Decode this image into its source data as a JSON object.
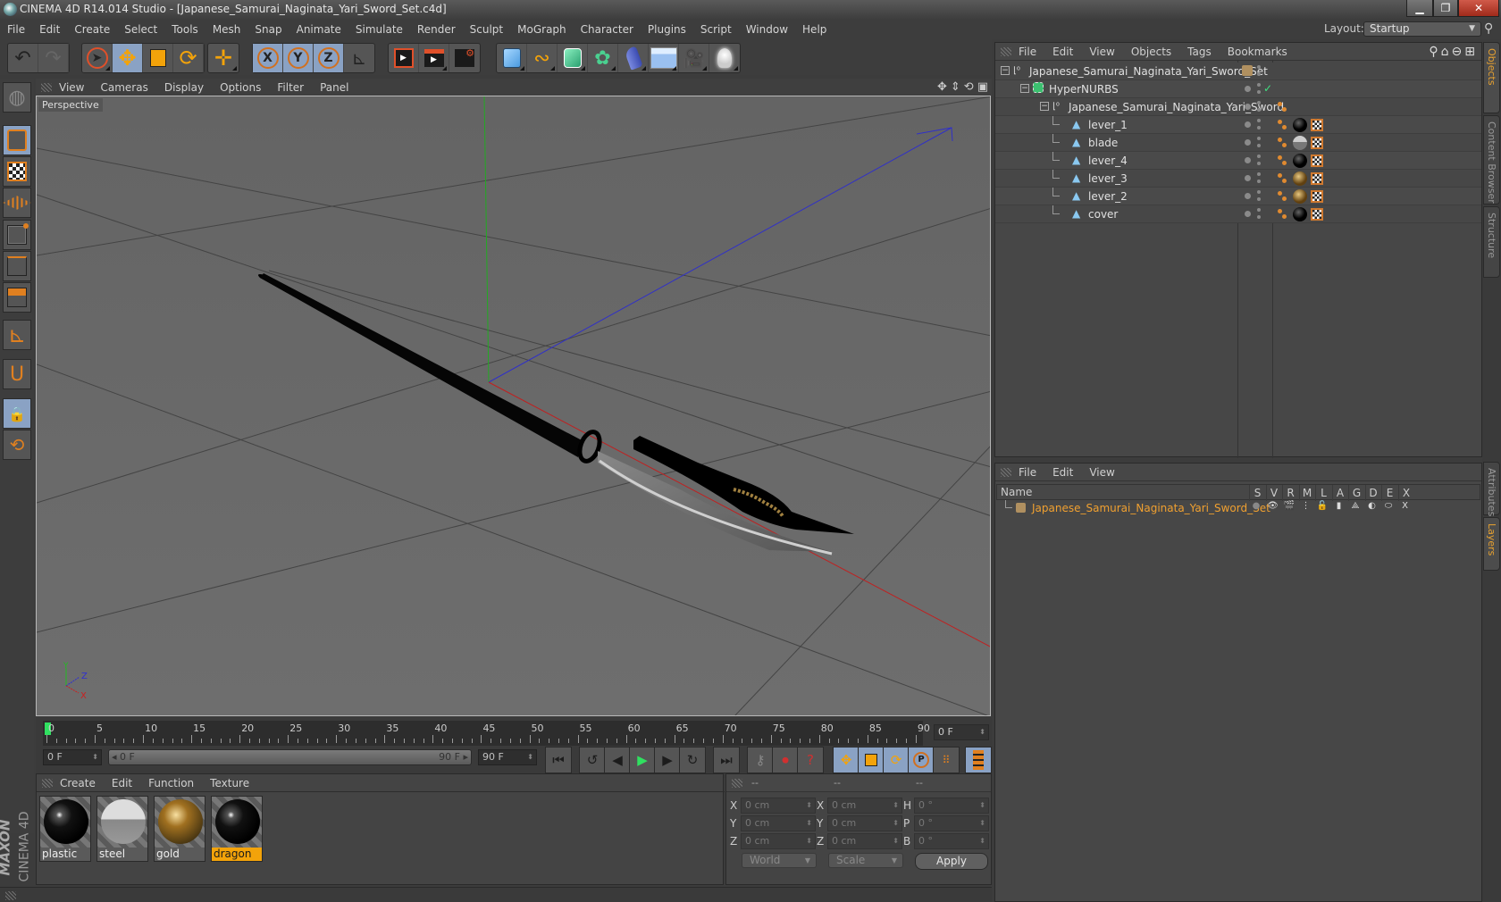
{
  "window": {
    "title": "CINEMA 4D R14.014 Studio - [Japanese_Samurai_Naginata_Yari_Sword_Set.c4d]",
    "minimize": "▁",
    "restore": "❐",
    "close": "✕"
  },
  "menubar": [
    "File",
    "Edit",
    "Create",
    "Select",
    "Tools",
    "Mesh",
    "Snap",
    "Animate",
    "Simulate",
    "Render",
    "Sculpt",
    "MoGraph",
    "Character",
    "Plugins",
    "Script",
    "Window",
    "Help"
  ],
  "layout": {
    "label": "Layout:",
    "value": "Startup"
  },
  "toolbar": {
    "groups": [
      [
        "undo-icon",
        "redo-icon"
      ],
      [
        "live-selection-icon",
        "move-icon",
        "scale-icon",
        "rotate-icon"
      ],
      [
        "add-object-icon"
      ],
      [
        "x-axis-icon",
        "y-axis-icon",
        "z-axis-icon",
        "coordinate-system-icon"
      ],
      [
        "render-view-icon",
        "render-picture-viewer-icon",
        "render-settings-icon"
      ],
      [
        "cube-icon",
        "spline-icon",
        "nurbs-icon",
        "mograph-cloner-icon",
        "deformer-icon",
        "floor-icon",
        "camera-icon",
        "light-icon"
      ]
    ]
  },
  "viewport": {
    "menu": [
      "View",
      "Cameras",
      "Display",
      "Options",
      "Filter",
      "Panel"
    ],
    "label": "Perspective",
    "axis": {
      "y": "Y",
      "z": "Z",
      "x": "X"
    }
  },
  "timeline": {
    "ticks": [
      "0",
      "5",
      "10",
      "15",
      "20",
      "25",
      "30",
      "35",
      "40",
      "45",
      "50",
      "55",
      "60",
      "65",
      "70",
      "75",
      "80",
      "85",
      "90"
    ],
    "current_frame": "0 F",
    "start_field": "0 F",
    "range_start": "0 F",
    "range_end": "90 F",
    "end_field": "90 F"
  },
  "materials": {
    "menu": [
      "Create",
      "Edit",
      "Function",
      "Texture"
    ],
    "items": [
      {
        "name": "plastic",
        "selected": false
      },
      {
        "name": "steel",
        "selected": false
      },
      {
        "name": "gold",
        "selected": false
      },
      {
        "name": "dragon",
        "selected": true
      }
    ]
  },
  "coords": {
    "headers": [
      "--",
      "--",
      "--"
    ],
    "pos": [
      {
        "axis": "X",
        "value": "0 cm"
      },
      {
        "axis": "Y",
        "value": "0 cm"
      },
      {
        "axis": "Z",
        "value": "0 cm"
      }
    ],
    "size": [
      {
        "axis": "X",
        "value": "0 cm"
      },
      {
        "axis": "Y",
        "value": "0 cm"
      },
      {
        "axis": "Z",
        "value": "0 cm"
      }
    ],
    "rot": [
      {
        "axis": "H",
        "value": "0 °"
      },
      {
        "axis": "P",
        "value": "0 °"
      },
      {
        "axis": "B",
        "value": "0 °"
      }
    ],
    "mode": "World",
    "transform": "Scale",
    "apply": "Apply"
  },
  "objects": {
    "menu": [
      "File",
      "Edit",
      "View",
      "Objects",
      "Tags",
      "Bookmarks"
    ],
    "rows": [
      {
        "name": "Japanese_Samurai_Naginata_Yari_Sword_Set",
        "type": "null",
        "depth": 0
      },
      {
        "name": "HyperNURBS",
        "type": "hypernurbs",
        "depth": 1
      },
      {
        "name": "Japanese_Samurai_Naginata_Yari_Sword",
        "type": "null",
        "depth": 2
      },
      {
        "name": "lever_1",
        "type": "polygon",
        "depth": 3,
        "material": "plastic"
      },
      {
        "name": "blade",
        "type": "polygon",
        "depth": 3,
        "material": "steel"
      },
      {
        "name": "lever_4",
        "type": "polygon",
        "depth": 3,
        "material": "plastic"
      },
      {
        "name": "lever_3",
        "type": "polygon",
        "depth": 3,
        "material": "gold"
      },
      {
        "name": "lever_2",
        "type": "polygon",
        "depth": 3,
        "material": "gold"
      },
      {
        "name": "cover",
        "type": "polygon",
        "depth": 3,
        "material": "dragon"
      }
    ]
  },
  "layers": {
    "menu": [
      "File",
      "Edit",
      "View"
    ],
    "columns": [
      "Name",
      "S",
      "V",
      "R",
      "M",
      "L",
      "A",
      "G",
      "D",
      "E",
      "X"
    ],
    "rows": [
      {
        "name": "Japanese_Samurai_Naginata_Yari_Sword_Set",
        "color": "#b09060"
      }
    ]
  },
  "right_tabs": {
    "top": [
      {
        "label": "Objects",
        "active": true
      },
      {
        "label": "Content Browser",
        "active": false
      },
      {
        "label": "Structure",
        "active": false
      }
    ],
    "bottom": [
      {
        "label": "Attributes",
        "active": false
      },
      {
        "label": "Layers",
        "active": true
      }
    ]
  },
  "branding": {
    "maxon": "MAXON",
    "product": "CINEMA 4D"
  },
  "colors": {
    "accent": "#f3a30a",
    "active_tool": "#8aa2c4",
    "layer_text": "#f0a030"
  }
}
